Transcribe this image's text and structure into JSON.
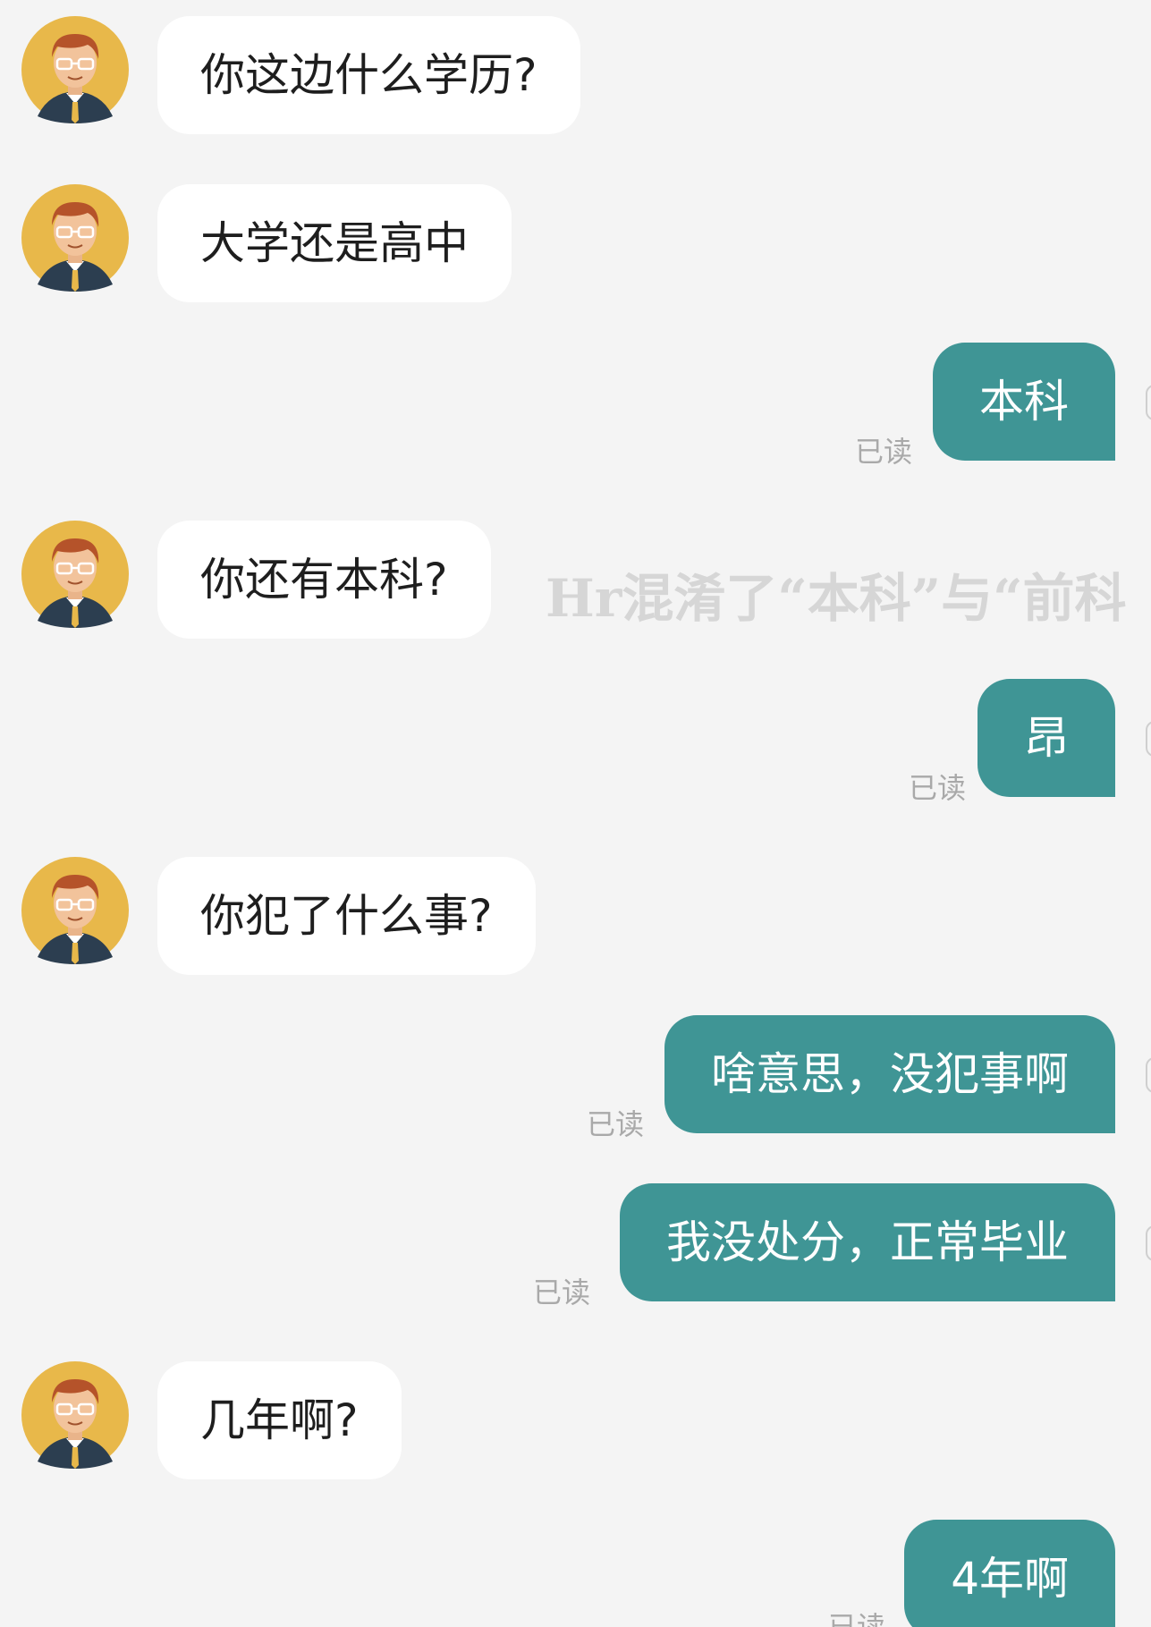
{
  "chat": {
    "read_label": "已读",
    "messages": [
      {
        "side": "in",
        "text": "你这边什么学历?"
      },
      {
        "side": "in",
        "text": "大学还是高中"
      },
      {
        "side": "out",
        "text": "本科"
      },
      {
        "side": "in",
        "text": "你还有本科?"
      },
      {
        "side": "out",
        "text": "昂"
      },
      {
        "side": "in",
        "text": "你犯了什么事?"
      },
      {
        "side": "out",
        "text": "啥意思，没犯事啊"
      },
      {
        "side": "out",
        "text": "我没处分，正常毕业"
      },
      {
        "side": "in",
        "text": "几年啊?"
      },
      {
        "side": "out",
        "text": "4年啊"
      }
    ]
  },
  "overlay": {
    "caption": "Hr混淆了“本科”与“前科"
  },
  "colors": {
    "background": "#f4f4f4",
    "incoming_bubble": "#ffffff",
    "outgoing_bubble": "#3f9595",
    "read_text": "#a9a9a9",
    "avatar_bg": "#e8b84a"
  }
}
